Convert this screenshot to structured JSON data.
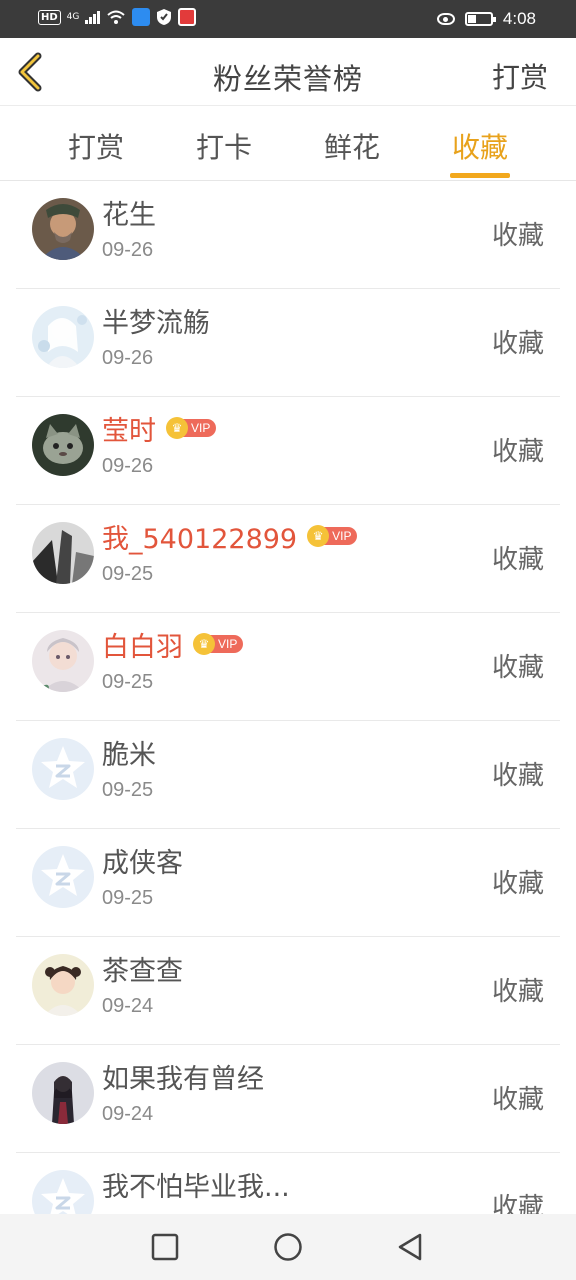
{
  "status_bar": {
    "left": {
      "hd": "HD",
      "network": "4G"
    },
    "time": "4:08"
  },
  "header": {
    "title": "粉丝荣誉榜",
    "action": "打赏",
    "back_icon": "chevron-left-icon"
  },
  "tabs": [
    {
      "label": "打赏",
      "active": false
    },
    {
      "label": "打卡",
      "active": false
    },
    {
      "label": "鲜花",
      "active": false
    },
    {
      "label": "收藏",
      "active": true
    }
  ],
  "colors": {
    "accent": "#f2a81d",
    "vip_name": "#e2553b",
    "vip_badge": "#ee6a5a"
  },
  "vip_badge_text": "VIP",
  "list": [
    {
      "name": "花生",
      "date": "09-26",
      "action": "收藏",
      "vip": false,
      "avatar": "portrait-warrior"
    },
    {
      "name": "半梦流觞",
      "date": "09-26",
      "action": "收藏",
      "vip": false,
      "avatar": "anime-white"
    },
    {
      "name": "莹时",
      "date": "09-26",
      "action": "收藏",
      "vip": true,
      "avatar": "cat-photo"
    },
    {
      "name": "我_540122899",
      "date": "09-25",
      "action": "收藏",
      "vip": true,
      "avatar": "building-bw"
    },
    {
      "name": "白白羽",
      "date": "09-25",
      "action": "收藏",
      "vip": true,
      "avatar": "anime-girl"
    },
    {
      "name": "脆米",
      "date": "09-25",
      "action": "收藏",
      "vip": false,
      "avatar": "default-star"
    },
    {
      "name": "成侠客",
      "date": "09-25",
      "action": "收藏",
      "vip": false,
      "avatar": "default-star"
    },
    {
      "name": "茶查查",
      "date": "09-24",
      "action": "收藏",
      "vip": false,
      "avatar": "child-photo"
    },
    {
      "name": "如果我有曾经",
      "date": "09-24",
      "action": "收藏",
      "vip": false,
      "avatar": "dark-portrait"
    },
    {
      "name": "我不怕毕业我...",
      "date": "",
      "action": "收藏",
      "vip": false,
      "avatar": "default-star"
    }
  ],
  "nav": [
    "recents-square-icon",
    "home-circle-icon",
    "back-triangle-icon"
  ]
}
